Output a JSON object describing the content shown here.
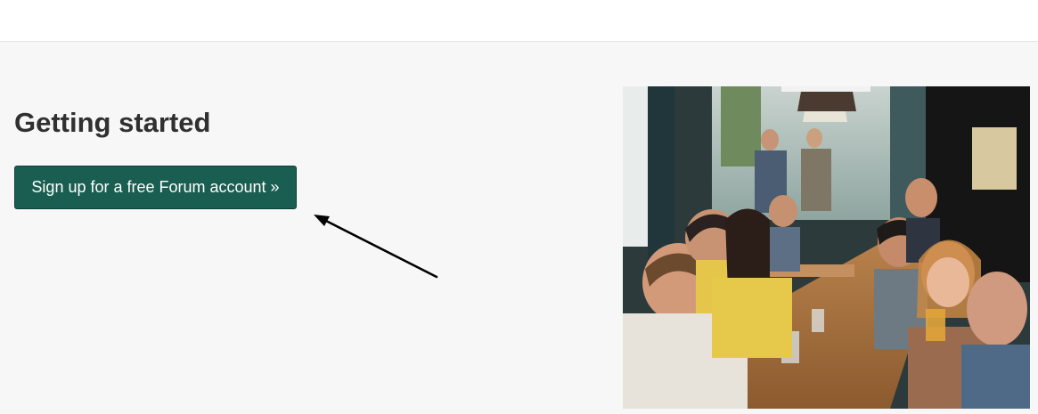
{
  "main": {
    "title": "Getting started",
    "signup_label": "Sign up for a free Forum account »"
  },
  "photo": {
    "description_icon": "people-at-restaurant-photo"
  },
  "colors": {
    "accent": "#1a5e52",
    "section_bg": "#f7f7f7",
    "heading": "#303030"
  }
}
